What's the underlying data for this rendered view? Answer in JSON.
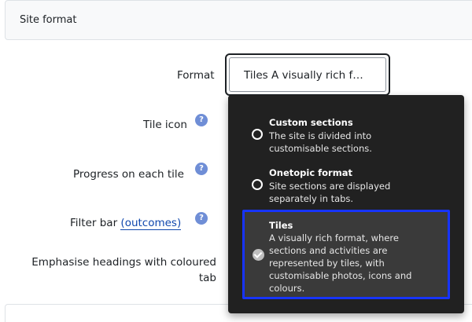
{
  "section": {
    "title": "Site format"
  },
  "fields": {
    "format_label": "Format",
    "tile_icon_label": "Tile icon",
    "progress_label": "Progress on each tile",
    "filter_bar_label": "Filter bar",
    "filter_bar_link": "(outcomes)",
    "emphasise_label_line1": "Emphasise headings with coloured",
    "emphasise_label_line2": "tab",
    "help_glyph": "?"
  },
  "format_select": {
    "value": "Tiles A visually rich f…"
  },
  "dropdown": {
    "options": [
      {
        "title": "Custom sections",
        "description_lines": [
          "The site is divided into",
          "customisable sections."
        ],
        "selected": false
      },
      {
        "title": "Onetopic format",
        "description_lines": [
          "Site sections are displayed",
          "separately in tabs."
        ],
        "selected": false
      },
      {
        "title": "Tiles",
        "description_lines": [
          "A visually rich format, where",
          "sections and activities are",
          "represented by tiles, with",
          "customisable photos, icons and",
          "colours."
        ],
        "selected": true
      }
    ]
  },
  "colors": {
    "help_icon": "#6f8ed6",
    "link": "#0f47ad",
    "dropdown_bg": "#212121",
    "selected_outline": "#1734ff"
  }
}
